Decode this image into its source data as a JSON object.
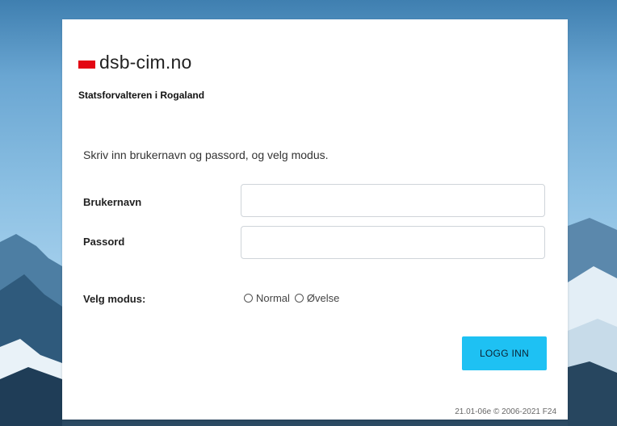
{
  "brand": {
    "logo_text": "dsb-cim.no",
    "brand_color": "#e30613",
    "organization": "Statsforvalteren i Rogaland"
  },
  "login": {
    "intro_text": "Skriv inn brukernavn og passord, og velg modus.",
    "username_label": "Brukernavn",
    "username_value": "",
    "password_label": "Passord",
    "password_value": "",
    "mode_label": "Velg modus:",
    "mode_options": [
      "Normal",
      "Øvelse"
    ],
    "mode_selected": null,
    "submit_label": "LOGG INN",
    "submit_color": "#1ec1f3"
  },
  "footer": {
    "version_text": "21.01-06e © 2006-2021 F24"
  }
}
